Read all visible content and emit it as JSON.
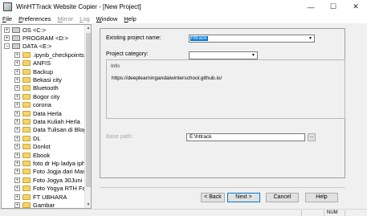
{
  "window": {
    "title": "WinHTTrack Website Copier - [New Project]",
    "minimize": "—",
    "maximize": "☐",
    "close": "✕"
  },
  "menu": [
    {
      "label": "File",
      "accel": "F",
      "rest": "ile",
      "enabled": true
    },
    {
      "label": "Preferences",
      "accel": "P",
      "rest": "references",
      "enabled": true
    },
    {
      "label": "Mirror",
      "accel": "M",
      "rest": "irror",
      "enabled": false
    },
    {
      "label": "Log",
      "accel": "L",
      "rest": "og",
      "enabled": false
    },
    {
      "label": "Window",
      "accel": "W",
      "rest": "indow",
      "enabled": true
    },
    {
      "label": "Help",
      "accel": "H",
      "rest": "elp",
      "enabled": true
    }
  ],
  "tree": [
    {
      "label": "OS <C:>",
      "kind": "drive",
      "expander": "+"
    },
    {
      "label": "PROGRAM <D:>",
      "kind": "drive",
      "expander": "+"
    },
    {
      "label": "DATA <E:>",
      "kind": "drive",
      "expander": "−"
    },
    {
      "label": ".ipynb_checkpoints",
      "kind": "folder",
      "expander": "+"
    },
    {
      "label": "ANFIS",
      "kind": "folder",
      "expander": "+"
    },
    {
      "label": "Backup",
      "kind": "folder",
      "expander": "+"
    },
    {
      "label": "Bekasi city",
      "kind": "folder",
      "expander": "+"
    },
    {
      "label": "Bluetooth",
      "kind": "folder",
      "expander": "+"
    },
    {
      "label": "Bogor city",
      "kind": "folder",
      "expander": "+"
    },
    {
      "label": "corona",
      "kind": "folder",
      "expander": "+"
    },
    {
      "label": "Data Herla",
      "kind": "folder",
      "expander": "+"
    },
    {
      "label": "Data Kuliah Herla",
      "kind": "folder",
      "expander": "+"
    },
    {
      "label": "Data Tulisan di Blog",
      "kind": "folder",
      "expander": "+"
    },
    {
      "label": "DL",
      "kind": "folder",
      "expander": "+"
    },
    {
      "label": "Donlot",
      "kind": "folder",
      "expander": "+"
    },
    {
      "label": "Ebook",
      "kind": "folder",
      "expander": "+"
    },
    {
      "label": "foto dr Hp ladya iphone",
      "kind": "folder",
      "expander": "+"
    },
    {
      "label": "Foto Jogja dari Mas Tom",
      "kind": "folder",
      "expander": "+"
    },
    {
      "label": "Foto Jogya 30Juni - 3 Ju",
      "kind": "folder",
      "expander": "+"
    },
    {
      "label": "Foto Yogya RTH Family",
      "kind": "folder",
      "expander": "+"
    },
    {
      "label": "FT UBHARA",
      "kind": "folder",
      "expander": "+"
    },
    {
      "label": "Gambar",
      "kind": "folder",
      "expander": "+"
    }
  ],
  "form": {
    "project_name_label": "Existing project name:",
    "project_name_value": "httrack",
    "category_label": "Project category:",
    "category_value": "",
    "info_title": "Info",
    "info_text": "https://deeplearningandaiwinterschool.github.io/",
    "base_path_label": "Base path:",
    "base_path_value": "E:\\httrack",
    "browse_label": "..."
  },
  "buttons": {
    "back": "< Back",
    "next": "Next >",
    "cancel": "Cancel",
    "help": "Help"
  },
  "status": {
    "num": "NUM"
  }
}
